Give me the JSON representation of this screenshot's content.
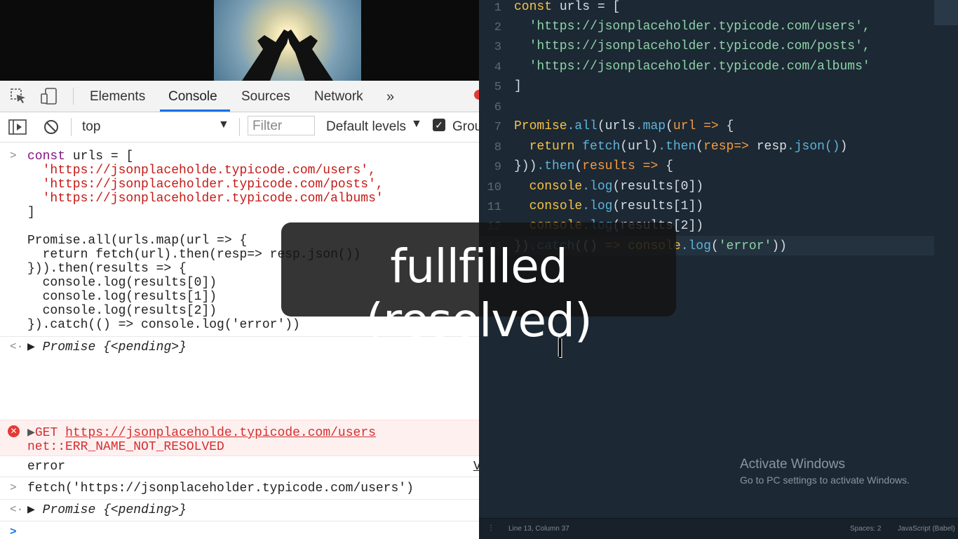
{
  "devtools": {
    "tabs": [
      "Elements",
      "Console",
      "Sources",
      "Network"
    ],
    "more_tabs_icon": "chevron-double-right-icon",
    "context": "top",
    "filter_placeholder": "Filter",
    "levels": "Default levels",
    "group_label": "Grou",
    "console": {
      "input1": {
        "lines": [
          "const urls = [",
          "  'https://jsonplaceholde.typicode.com/users',",
          "  'https://jsonplaceholder.typicode.com/posts',",
          "  'https://jsonplaceholder.typicode.com/albums'",
          "]",
          "",
          "Promise.all(urls.map(url => {",
          "  return fetch(url).then(resp=> resp.json())",
          "})).then(results => {",
          "  console.log(results[0])",
          "  console.log(results[1])",
          "  console.log(results[2])",
          "}).catch(() => console.log('error'))"
        ]
      },
      "result1": "Promise {<pending>}",
      "error": {
        "method": "GET",
        "url": "https://jsonplaceholde.typicode.com/users",
        "message": "net::ERR_NAME_NOT_RESOLVED"
      },
      "log_error": "error",
      "log_source": "V",
      "input2": "fetch('https://jsonplaceholder.typicode.com/users')",
      "result2": "Promise {<pending>}"
    }
  },
  "editor": {
    "lines": [
      {
        "n": "1",
        "text": "const urls = ["
      },
      {
        "n": "2",
        "text": "  'https://jsonplaceholder.typicode.com/users',"
      },
      {
        "n": "3",
        "text": "  'https://jsonplaceholder.typicode.com/posts',"
      },
      {
        "n": "4",
        "text": "  'https://jsonplaceholder.typicode.com/albums'"
      },
      {
        "n": "5",
        "text": "]"
      },
      {
        "n": "6",
        "text": ""
      },
      {
        "n": "7",
        "text": "Promise.all(urls.map(url => {"
      },
      {
        "n": "8",
        "text": "  return fetch(url).then(resp=> resp.json())"
      },
      {
        "n": "9",
        "text": "})).then(results => {"
      },
      {
        "n": "10",
        "text": "  console.log(results[0])"
      },
      {
        "n": "11",
        "text": "  console.log(results[1])"
      },
      {
        "n": "12",
        "text": "  console.log(results[2])"
      },
      {
        "n": "13",
        "text": "}).catch(() => console.log('error'))"
      }
    ],
    "status_position": "Line 13, Column 37",
    "status_spaces": "Spaces: 2",
    "status_syntax": "JavaScript (Babel)"
  },
  "watermark": {
    "title": "Activate Windows",
    "subtitle": "Go to PC settings to activate Windows."
  },
  "overlay_caption": "fullfilled (resolved)",
  "colors": {
    "devtools_accent": "#1a73e8",
    "editor_bg": "#1c2834",
    "error_red": "#d32f2f"
  }
}
